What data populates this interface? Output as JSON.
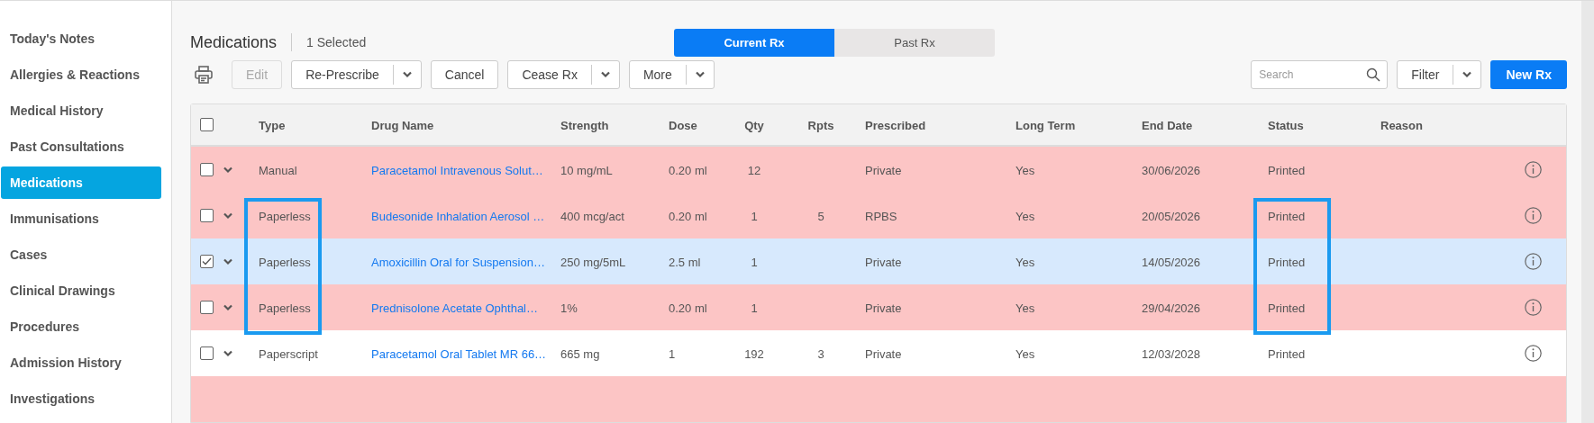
{
  "sidebar": {
    "items": [
      {
        "label": "Today's Notes",
        "selected": false
      },
      {
        "label": "Allergies & Reactions",
        "selected": false
      },
      {
        "label": "Medical History",
        "selected": false
      },
      {
        "label": "Past Consultations",
        "selected": false
      },
      {
        "label": "Medications",
        "selected": true
      },
      {
        "label": "Immunisations",
        "selected": false
      },
      {
        "label": "Cases",
        "selected": false
      },
      {
        "label": "Clinical Drawings",
        "selected": false
      },
      {
        "label": "Procedures",
        "selected": false
      },
      {
        "label": "Admission History",
        "selected": false
      },
      {
        "label": "Investigations",
        "selected": false
      }
    ]
  },
  "header": {
    "title": "Medications",
    "selection_count": "1 Selected"
  },
  "tabs": [
    {
      "label": "Current Rx",
      "selected": true
    },
    {
      "label": "Past Rx",
      "selected": false
    }
  ],
  "toolbar": {
    "buttons": [
      {
        "label": "Edit",
        "kind": "plain",
        "disabled": true
      },
      {
        "label": "Re-Prescribe",
        "kind": "split",
        "disabled": false
      },
      {
        "label": "Cancel",
        "kind": "plain",
        "disabled": false
      },
      {
        "label": "Cease Rx",
        "kind": "split",
        "disabled": false
      },
      {
        "label": "More",
        "kind": "split",
        "disabled": false
      }
    ],
    "search": {
      "placeholder": "Search"
    },
    "right_buttons": [
      {
        "label": "Filter",
        "kind": "split",
        "disabled": false
      },
      {
        "label": "New Rx",
        "kind": "primary",
        "disabled": false
      }
    ]
  },
  "table": {
    "all_checked": false,
    "columns": [
      {
        "label": "Type",
        "framed": true
      },
      {
        "label": "Drug Name",
        "framed": false
      },
      {
        "label": "Strength",
        "framed": false
      },
      {
        "label": "Dose",
        "framed": false
      },
      {
        "label": "Qty",
        "framed": false
      },
      {
        "label": "Rpts",
        "framed": false
      },
      {
        "label": "Prescribed",
        "framed": false
      },
      {
        "label": "Long Term",
        "framed": false
      },
      {
        "label": "End Date",
        "framed": false
      },
      {
        "label": "Status",
        "framed": true
      },
      {
        "label": "Reason",
        "framed": false
      }
    ],
    "rows": [
      {
        "selected": false,
        "flagged": true,
        "framed": false,
        "cells": [
          "Manual",
          "Paracetamol Intravenous Solut…",
          "10 mg/mL",
          "0.20 ml",
          "12",
          "",
          "Private",
          "Yes",
          "30/06/2026",
          "Printed",
          ""
        ]
      },
      {
        "selected": false,
        "flagged": true,
        "framed": true,
        "cells": [
          "Paperless",
          "Budesonide Inhalation Aerosol …",
          "400 mcg/act",
          "0.20 ml",
          "1",
          "5",
          "RPBS",
          "Yes",
          "20/05/2026",
          "Printed",
          ""
        ]
      },
      {
        "selected": true,
        "framed": true,
        "cells": [
          "Paperless",
          "Amoxicillin Oral for Suspension…",
          "250 mg/5mL",
          "2.5 ml",
          "1",
          "",
          "Private",
          "Yes",
          "14/05/2026",
          "Printed",
          ""
        ]
      },
      {
        "selected": false,
        "flagged": true,
        "framed": true,
        "cells": [
          "Paperless",
          "Prednisolone Acetate Ophthal…",
          "1%",
          "0.20 ml",
          "1",
          "",
          "Private",
          "Yes",
          "29/04/2026",
          "Printed",
          ""
        ]
      },
      {
        "selected": false,
        "flagged": false,
        "framed": false,
        "cells": [
          "Paperscript",
          "Paracetamol Oral Tablet MR 66…",
          "665 mg",
          "1",
          "192",
          "3",
          "Private",
          "Yes",
          "12/03/2028",
          "Printed",
          ""
        ]
      },
      {
        "selected": false,
        "flagged": true,
        "framed": false,
        "cells": []
      }
    ]
  }
}
